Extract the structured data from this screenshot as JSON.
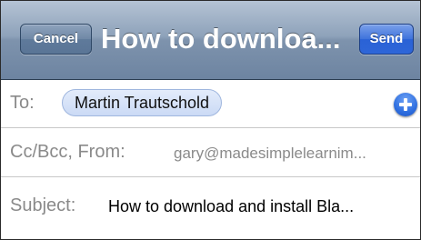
{
  "navbar": {
    "cancel_label": "Cancel",
    "title": "How to downloa...",
    "send_label": "Send"
  },
  "to_row": {
    "label": "To:",
    "recipient": "Martin Trautschold",
    "add_icon": "plus-circle-icon"
  },
  "cc_row": {
    "label": "Cc/Bcc, From:",
    "from_value": "gary@madesimplelearnim..."
  },
  "subject_row": {
    "label": "Subject:",
    "value": "How to download and install Bla..."
  },
  "colors": {
    "navbar": "#7e93ad",
    "send_button": "#2e66d8",
    "recipient_chip": "#cbdaf5"
  }
}
